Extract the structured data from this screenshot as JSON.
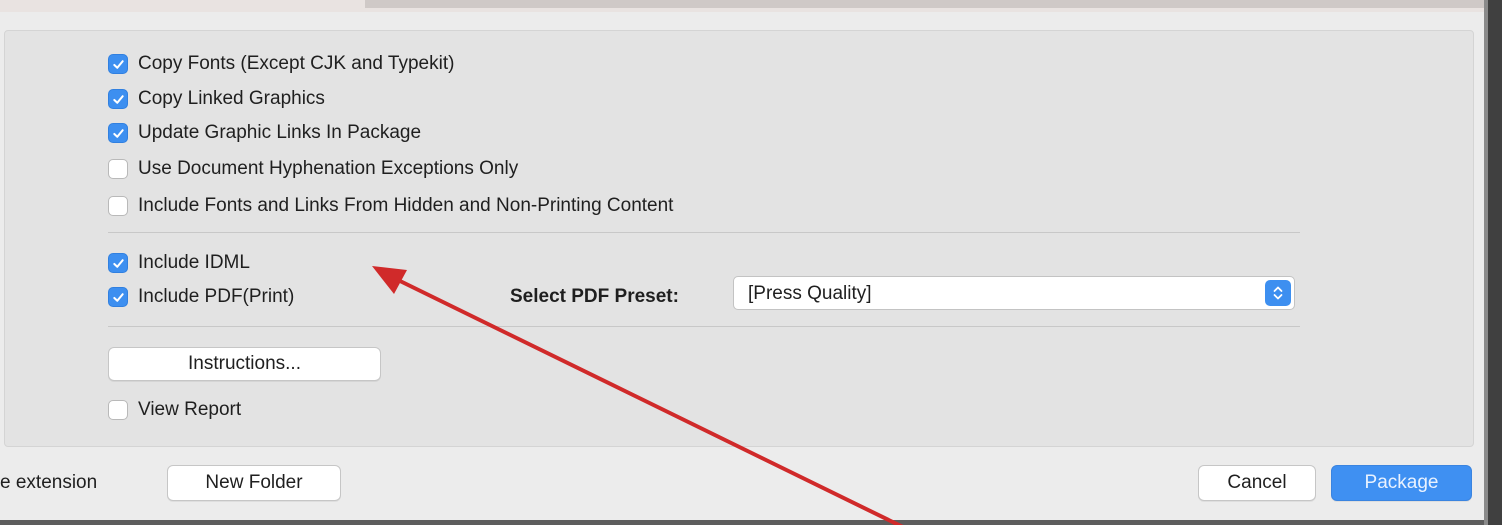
{
  "options": {
    "copy_fonts": {
      "label": "Copy Fonts (Except CJK and Typekit)",
      "checked": true
    },
    "copy_linked_graphics": {
      "label": "Copy Linked Graphics",
      "checked": true
    },
    "update_graphic_links": {
      "label": "Update Graphic Links In Package",
      "checked": true
    },
    "hyphenation_exceptions": {
      "label": "Use Document Hyphenation Exceptions Only",
      "checked": false
    },
    "include_hidden_content": {
      "label": "Include Fonts and Links From Hidden and Non-Printing Content",
      "checked": false
    },
    "include_idml": {
      "label": "Include IDML",
      "checked": true
    },
    "include_pdf": {
      "label": "Include PDF(Print)",
      "checked": true
    },
    "view_report": {
      "label": "View Report",
      "checked": false
    }
  },
  "pdf_preset": {
    "label": "Select PDF Preset:",
    "value": "[Press Quality]"
  },
  "buttons": {
    "instructions": "Instructions...",
    "new_folder": "New Folder",
    "cancel": "Cancel",
    "package": "Package"
  },
  "footer": {
    "extension_text": "e extension"
  },
  "colors": {
    "accent": "#3d8ff0",
    "annotation_arrow": "#d02a2a"
  },
  "icons": [
    "checkmark-icon",
    "updown-chevron-icon",
    "annotation-arrow"
  ]
}
